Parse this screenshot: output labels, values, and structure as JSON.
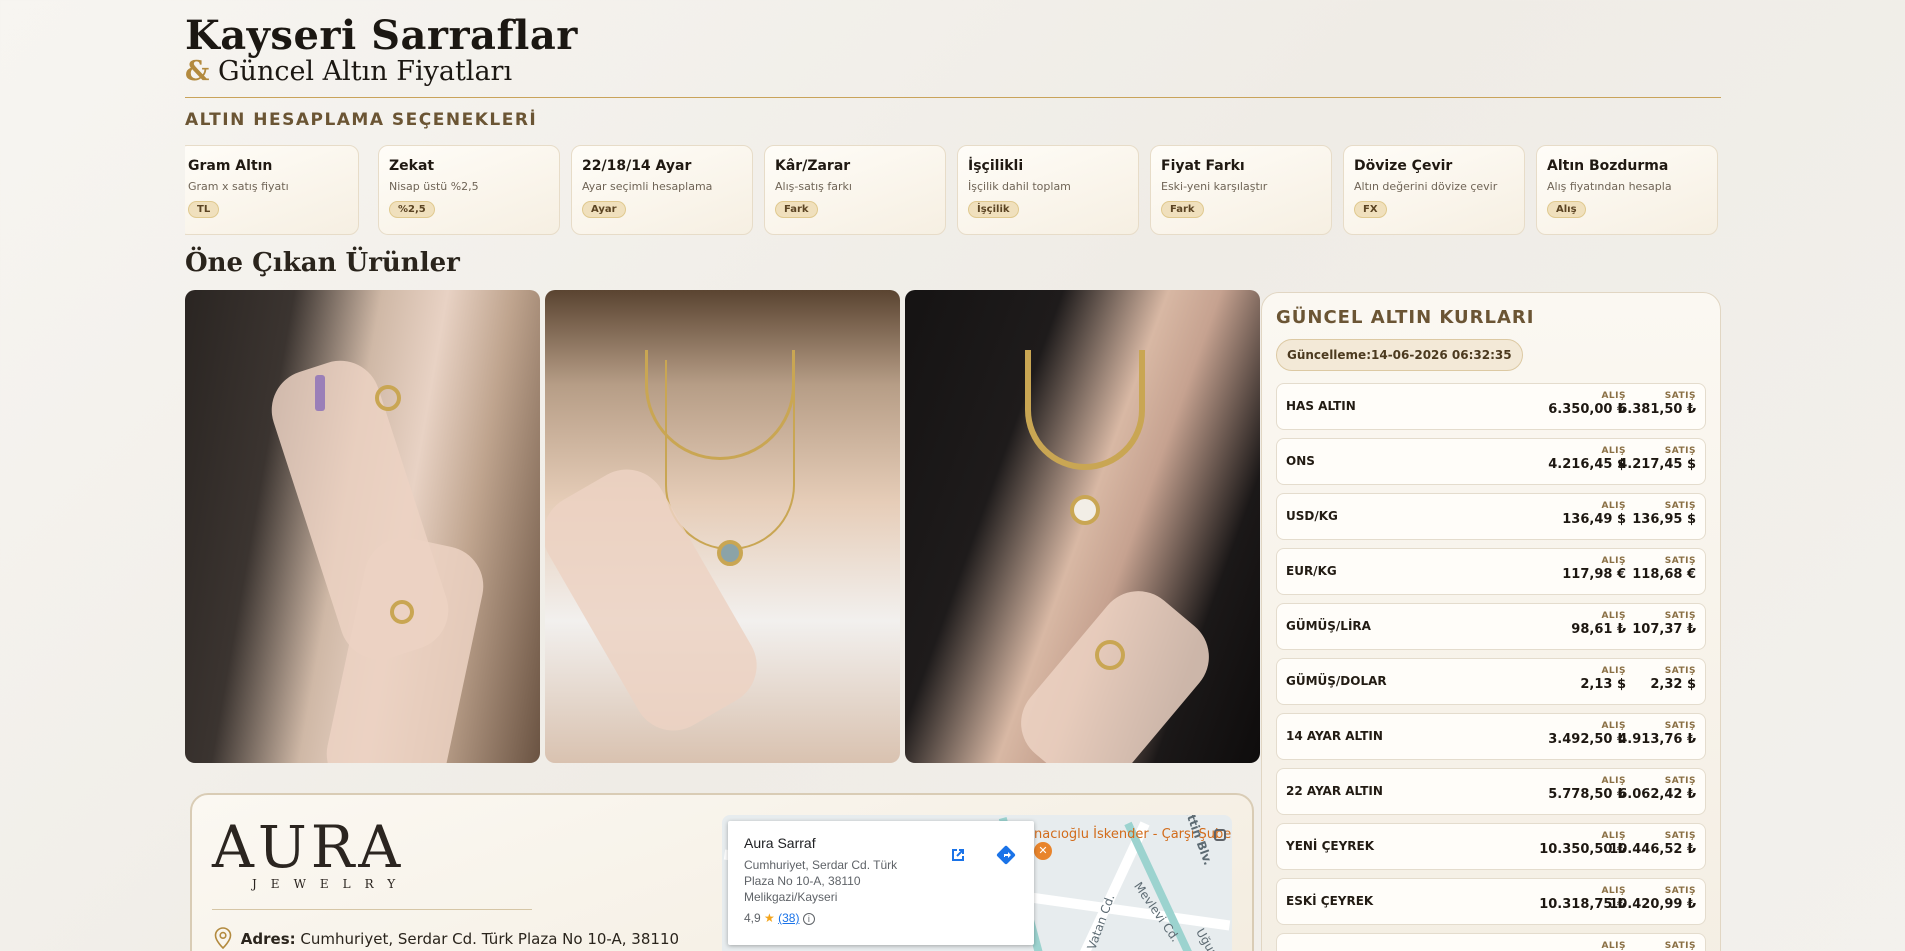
{
  "header": {
    "title": "Kayseri Sarraflar",
    "subtitle_amp": "&",
    "subtitle": "Güncel Altın Fiyatları"
  },
  "calc": {
    "title": "ALTIN HESAPLAMA SEÇENEKLERİ",
    "cards": [
      {
        "title": "Gram Altın",
        "desc": "Gram x satış fiyatı",
        "badge": "TL"
      },
      {
        "title": "Zekat",
        "desc": "Nisap üstü %2,5",
        "badge": "%2,5"
      },
      {
        "title": "22/18/14 Ayar",
        "desc": "Ayar seçimli hesaplama",
        "badge": "Ayar"
      },
      {
        "title": "Kâr/Zarar",
        "desc": "Alış-satış farkı",
        "badge": "Fark"
      },
      {
        "title": "İşçilikli",
        "desc": "İşçilik dahil toplam",
        "badge": "İşçilik"
      },
      {
        "title": "Fiyat Farkı",
        "desc": "Eski-yeni karşılaştır",
        "badge": "Fark"
      },
      {
        "title": "Dövize Çevir",
        "desc": "Altın değerini dövize çevir",
        "badge": "FX"
      },
      {
        "title": "Altın Bozdurma",
        "desc": "Alış fiyatından hesapla",
        "badge": "Alış"
      }
    ]
  },
  "featured": {
    "title": "Öne Çıkan Ürünler"
  },
  "aura": {
    "logo": "AURA",
    "logo_sub": "JEWELRY",
    "address_label": "Adres:",
    "address": "Cumhuriyet, Serdar Cd. Türk Plaza No 10-A, 38110"
  },
  "map": {
    "place_name": "Aura Sarraf",
    "place_address": "Cumhuriyet, Serdar Cd. Türk Plaza No 10-A, 38110 Melikgazi/Kayseri",
    "rating": "4,9",
    "reviews": "(38)",
    "poi": "nacıoğlu İskender - Çarşı Şube",
    "street1": "Vatan Cd.",
    "street2": "Mevlevi Cd.",
    "street3": "nettin Blv.",
    "street4": "Uğur"
  },
  "rates": {
    "title": "GÜNCEL ALTIN KURLARI",
    "updated_label": "Güncelleme:",
    "updated_value": "14-06-2026 06:32:35",
    "buy_label": "ALIŞ",
    "sell_label": "SATIŞ",
    "rows": [
      {
        "name": "HAS ALTIN",
        "buy": "6.350,00 ₺",
        "sell": "6.381,50 ₺"
      },
      {
        "name": "ONS",
        "buy": "4.216,45 $",
        "sell": "4.217,45 $"
      },
      {
        "name": "USD/KG",
        "buy": "136,49 $",
        "sell": "136,95 $"
      },
      {
        "name": "EUR/KG",
        "buy": "117,98 €",
        "sell": "118,68 €"
      },
      {
        "name": "GÜMÜŞ/LİRA",
        "buy": "98,61 ₺",
        "sell": "107,37 ₺"
      },
      {
        "name": "GÜMÜŞ/DOLAR",
        "buy": "2,13 $",
        "sell": "2,32 $"
      },
      {
        "name": "14 AYAR ALTIN",
        "buy": "3.492,50 ₺",
        "sell": "4.913,76 ₺"
      },
      {
        "name": "22 AYAR ALTIN",
        "buy": "5.778,50 ₺",
        "sell": "6.062,42 ₺"
      },
      {
        "name": "YENİ ÇEYREK",
        "buy": "10.350,50 ₺",
        "sell": "10.446,52 ₺"
      },
      {
        "name": "ESKİ ÇEYREK",
        "buy": "10.318,75 ₺",
        "sell": "10.420,99 ₺"
      },
      {
        "name": "",
        "buy": "",
        "sell": ""
      }
    ]
  },
  "colors": {
    "accent_gold": "#b38a3e",
    "heading_brown": "#6b5534"
  }
}
